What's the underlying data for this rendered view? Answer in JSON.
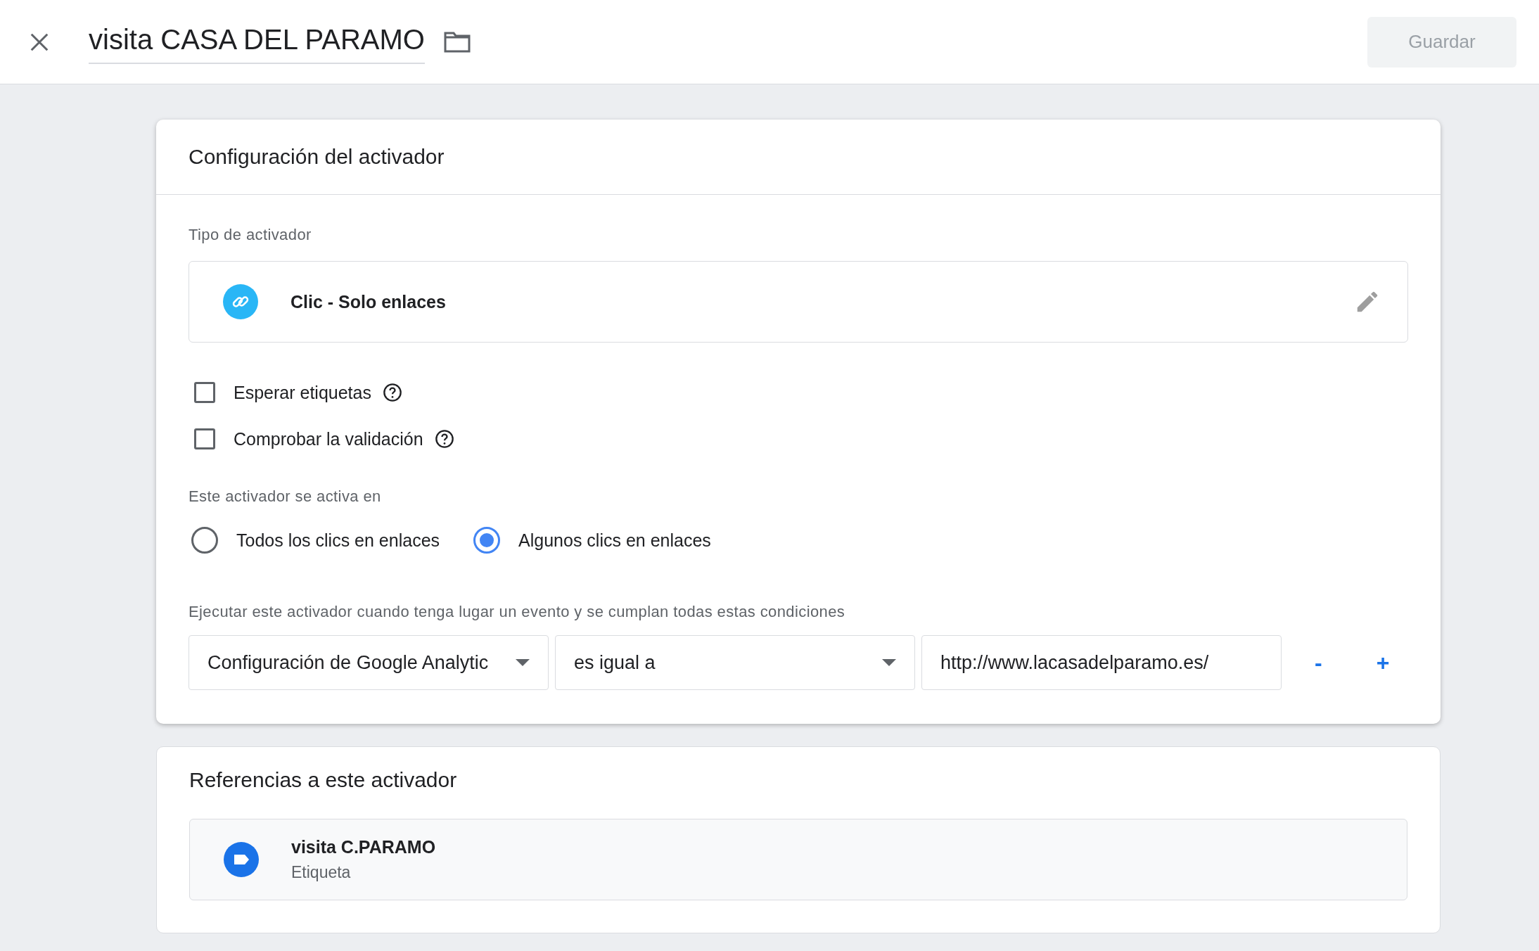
{
  "header": {
    "title": "visita CASA DEL PARAMO",
    "save_button": {
      "label": "Guardar",
      "disabled": true
    }
  },
  "config": {
    "title": "Configuración del activador",
    "type_label": "Tipo de activador",
    "trigger_type": "Clic - Solo enlaces",
    "options": [
      {
        "label": "Esperar etiquetas",
        "checked": false
      },
      {
        "label": "Comprobar la validación",
        "checked": false
      }
    ],
    "fires_label": "Este activador se activa en",
    "fires_on": [
      {
        "label": "Todos los clics en enlaces",
        "selected": false
      },
      {
        "label": "Algunos clics en enlaces",
        "selected": true
      }
    ],
    "conditions_label": "Ejecutar este activador cuando tenga lugar un evento y se cumplan todas estas condiciones",
    "condition": {
      "variable": "Configuración de Google Analytic",
      "operator": "es igual a",
      "value": "http://www.lacasadelparamo.es/",
      "remove": "-",
      "add": "+"
    }
  },
  "references": {
    "title": "Referencias a este activador",
    "items": [
      {
        "name": "visita C.PARAMO",
        "type": "Etiqueta"
      }
    ]
  }
}
